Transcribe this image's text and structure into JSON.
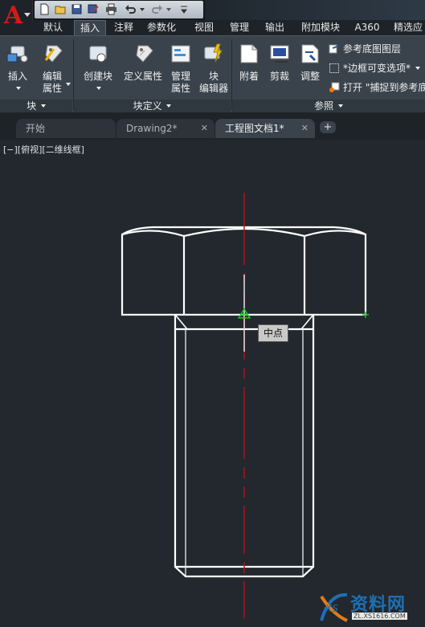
{
  "ribbon_tabs": [
    "默认",
    "插入",
    "注释",
    "参数化",
    "视图",
    "管理",
    "输出",
    "附加模块",
    "A360",
    "精选应"
  ],
  "active_tab": "插入",
  "panels": {
    "block": {
      "title": "块",
      "insert_label": "插入",
      "edit_attr_label_1": "编辑",
      "edit_attr_label_2": "属性"
    },
    "block_def": {
      "title": "块定义",
      "create_label": "创建块",
      "define_attr_label": "定义属性",
      "manage_attr_label_1": "管理",
      "manage_attr_label_2": "属性",
      "block_editor_label_1": "块",
      "block_editor_label_2": "编辑器"
    },
    "reference": {
      "title": "参照",
      "attach_label": "附着",
      "clip_label": "剪裁",
      "adjust_label": "调整",
      "underlay_layers_label": "参考底图图层",
      "frame_label": "*边框可变选项*",
      "snap_label": "打开 \"捕捉到参考底"
    }
  },
  "doc_tabs": [
    {
      "label": "开始"
    },
    {
      "label": "Drawing2*"
    },
    {
      "label": "工程图文档1*"
    }
  ],
  "viewport_label": "[−][俯视][二维线框]",
  "tooltip": "中点",
  "watermark": {
    "text": "资料网",
    "url": "ZL.XS1616.COM"
  },
  "colors": {
    "canvas_bg": "#22282e",
    "ribbon_bg": "#3a434c",
    "centerline": "#b3151c",
    "snap_marker": "#1ec51e"
  }
}
